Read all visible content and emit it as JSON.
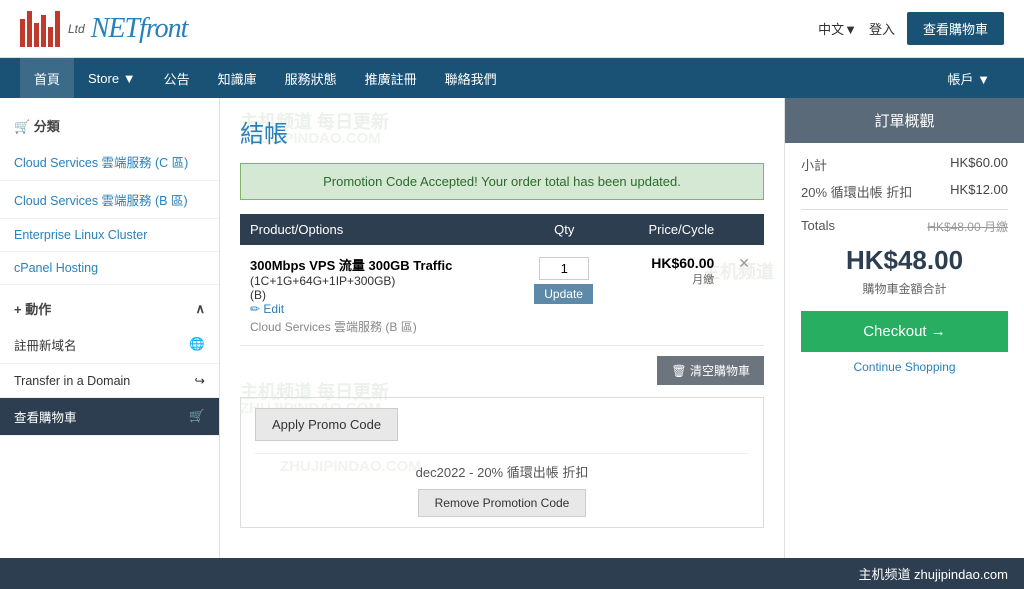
{
  "header": {
    "logo_ltd": "Ltd",
    "logo_net": "NET",
    "logo_front": "front",
    "lang_label": "中文▼",
    "login_label": "登入",
    "cart_btn_label": "查看購物車"
  },
  "navbar": {
    "items": [
      {
        "id": "home",
        "label": "首頁"
      },
      {
        "id": "store",
        "label": "Store ▼"
      },
      {
        "id": "announcements",
        "label": "公告"
      },
      {
        "id": "knowledgebase",
        "label": "知識庫"
      },
      {
        "id": "service-status",
        "label": "服務狀態"
      },
      {
        "id": "promotions",
        "label": "推廣註冊"
      },
      {
        "id": "contact",
        "label": "聯絡我們"
      },
      {
        "id": "account",
        "label": "帳戶 ▼"
      }
    ]
  },
  "sidebar": {
    "category_label": "🛒 分類",
    "categories": [
      "Cloud Services 雲端服務 (C 區)",
      "Cloud Services 雲端服務 (B 區)",
      "Enterprise Linux Cluster",
      "cPanel Hosting"
    ],
    "actions_label": "+ 動作",
    "actions": [
      {
        "id": "register-domain",
        "label": "註冊新域名",
        "icon": "🌐"
      },
      {
        "id": "transfer-domain",
        "label": "Transfer in a Domain",
        "icon": "↪"
      },
      {
        "id": "view-cart",
        "label": "查看購物車",
        "icon": "🛒",
        "active": true
      }
    ]
  },
  "main": {
    "title": "結帳",
    "promo_success_msg": "Promotion Code Accepted! Your order total has been updated.",
    "table_headers": {
      "product": "Product/Options",
      "qty": "Qty",
      "price": "Price/Cycle"
    },
    "cart_items": [
      {
        "name": "300Mbps VPS 流量 300GB Traffic",
        "details": "(1C+1G+64G+1IP+300GB)",
        "zone": "(B)",
        "edit_label": "✏ Edit",
        "qty": "1",
        "update_label": "Update",
        "price": "HK$60.00",
        "cycle": "月繳"
      }
    ],
    "clear_cart_label": "🗑 清空購物車",
    "promo_btn_label": "Apply Promo Code",
    "promo_applied": {
      "code_label": "dec2022 - 20% 循環出帳 折扣",
      "remove_label": "Remove Promotion Code"
    }
  },
  "order_summary": {
    "header": "訂單概觀",
    "subtotal_label": "小計",
    "subtotal_value": "HK$60.00",
    "discount_label": "20% 循環出帳 折扣",
    "discount_value": "HK$12.00",
    "totals_label": "Totals",
    "totals_strike": "HK$48.00 月繳",
    "total_big": "HK$48.00",
    "total_sub": "購物車金額合計",
    "checkout_label": "Checkout →",
    "continue_label": "Continue Shopping"
  },
  "footer": {
    "text": "主机频道 zhujipindao.com"
  },
  "watermarks": [
    "主机频道 每日更新",
    "ZHUJIPINDAO.COM",
    "主机频道 每日更新",
    "ZHUJIPINDAO.COM"
  ]
}
